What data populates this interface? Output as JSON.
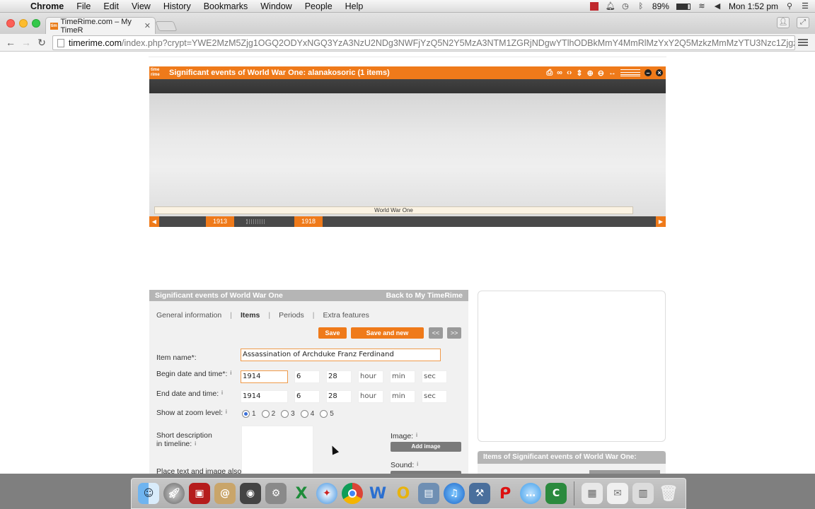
{
  "menubar": {
    "app": "Chrome",
    "items": [
      "File",
      "Edit",
      "View",
      "History",
      "Bookmarks",
      "Window",
      "People",
      "Help"
    ],
    "battery": "89%",
    "clock": "Mon 1:52 pm"
  },
  "browser": {
    "tab_title": "TimeRime.com – My TimeR",
    "favicon_text": "tim",
    "url_domain": "timerime.com",
    "url_path": "/index.php?crypt=YWE2MzM5Zjg1OGQ2ODYxNGQ3YzA3NzU2NDg3NWFjYzQ5N2Y5MzA3NTM1ZGRjNDgwYTlhODBkMmY4MmRlMzYxY2Q5MzkzMmMzYTU3Nzc1ZjgzZjE…"
  },
  "timeline": {
    "logo": "time rime",
    "title": "Significant events of World War One: alanakosoric  (1 items)",
    "period_label": "World War One",
    "handle_start": "1913",
    "handle_end": "1918",
    "left_arrow": "◀",
    "right_arrow": "▶"
  },
  "form": {
    "panel_title": "Significant events of World War One",
    "back_link": "Back to My TimeRime",
    "tabs": [
      "General information",
      "Items",
      "Periods",
      "Extra features"
    ],
    "active_tab": "Items",
    "save": "Save",
    "save_new": "Save and new",
    "prev": "<<",
    "next": ">>",
    "item_name_label": "Item name*:",
    "item_name": "Assassination of Archduke Franz Ferdinand",
    "begin_label": "Begin date and time*:",
    "begin": {
      "year": "1914",
      "month": "6",
      "day": "28",
      "hour": "hour",
      "min": "min",
      "sec": "sec"
    },
    "end_label": "End date and time:",
    "end": {
      "year": "1914",
      "month": "6",
      "day": "28",
      "hour": "hour",
      "min": "min",
      "sec": "sec"
    },
    "zoom_label": "Show at zoom level:",
    "zoom_levels": [
      "1",
      "2",
      "3",
      "4",
      "5"
    ],
    "zoom_selected": "1",
    "short_desc_label_1": "Short description",
    "short_desc_label_2": "in timeline:",
    "place_label": "Place text and image also",
    "image_label": "Image:",
    "add_image": "Add image",
    "sound_label": "Sound:",
    "info": "i"
  },
  "items_panel": {
    "title": "Items of Significant events of World War One:"
  },
  "dock": {
    "icons": [
      "finder-icon",
      "launchpad-icon",
      "photo-booth-icon",
      "contacts-icon",
      "facetime-icon",
      "system-preferences-icon",
      "excel-icon",
      "safari-icon",
      "chrome-icon",
      "word-icon",
      "office-icon",
      "preview-icon",
      "itunes-icon",
      "xcode-icon",
      "acrobat-icon",
      "messages-icon",
      "camtasia-icon",
      "documents-icon",
      "mail-icon",
      "files-icon",
      "trash-icon"
    ]
  }
}
